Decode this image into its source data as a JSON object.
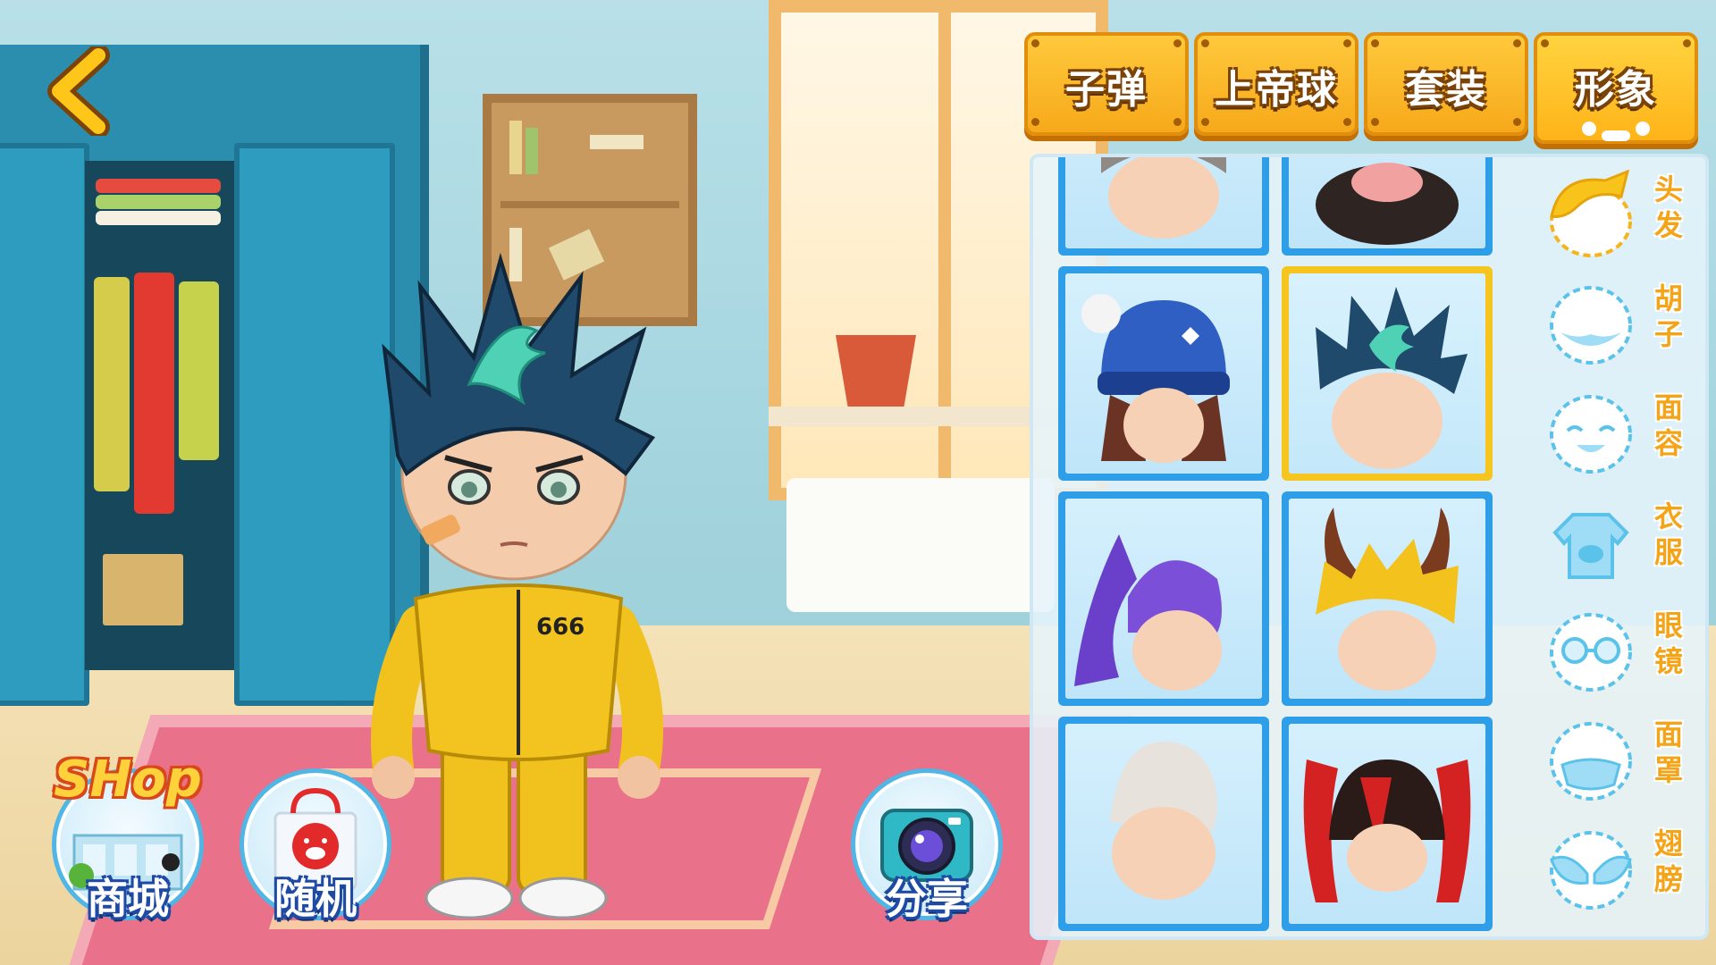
{
  "tabs": [
    {
      "label": "子弹",
      "active": false
    },
    {
      "label": "上帝球",
      "active": false
    },
    {
      "label": "套装",
      "active": false
    },
    {
      "label": "形象",
      "active": true
    }
  ],
  "categories": [
    {
      "label": "头发",
      "icon": "hair-icon",
      "active": true
    },
    {
      "label": "胡子",
      "icon": "beard-icon",
      "active": false
    },
    {
      "label": "面容",
      "icon": "face-icon",
      "active": false
    },
    {
      "label": "衣服",
      "icon": "clothes-icon",
      "active": false
    },
    {
      "label": "眼镜",
      "icon": "glasses-icon",
      "active": false
    },
    {
      "label": "面罩",
      "icon": "mask-icon",
      "active": false
    },
    {
      "label": "翅膀",
      "icon": "wings-icon",
      "active": false
    }
  ],
  "items": [
    {
      "name": "grey-hair-partial",
      "selected": false
    },
    {
      "name": "black-hair-pig-partial",
      "selected": false
    },
    {
      "name": "blue-snowflake-beanie-hair",
      "selected": false
    },
    {
      "name": "spiky-blue-green-hair",
      "selected": true
    },
    {
      "name": "purple-ponytail-hair",
      "selected": false
    },
    {
      "name": "golden-horned-hair",
      "selected": false
    },
    {
      "name": "white-quiff-hair",
      "selected": false
    },
    {
      "name": "red-black-twintail-hair",
      "selected": false
    }
  ],
  "character": {
    "jacket_number": "666"
  },
  "buttons": {
    "shop_sign": "SHop",
    "shop_label": "商城",
    "random_label": "随机",
    "share_label": "分享"
  },
  "colors": {
    "tab_gold": "#f6a91a",
    "card_blue": "#2f9ee8",
    "card_selected": "#f6c51f",
    "category_orange": "#f5a317"
  }
}
